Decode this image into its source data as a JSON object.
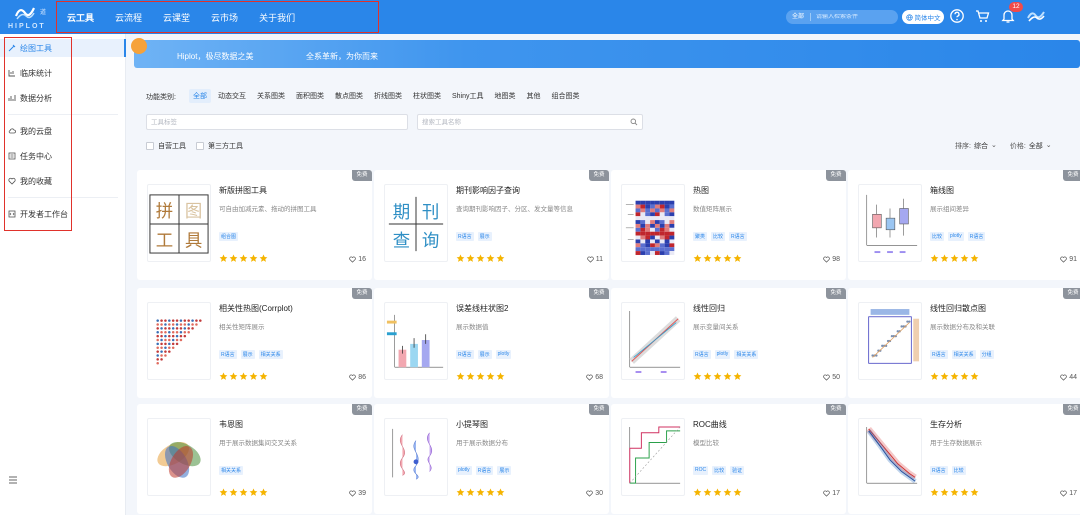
{
  "brand": {
    "name": "HIPLOT",
    "sub": "道"
  },
  "nav": {
    "items": [
      "云工具",
      "云流程",
      "云课堂",
      "云市场",
      "关于我们"
    ],
    "active": 0
  },
  "header": {
    "search_scope": "全部",
    "search_placeholder": "请输入检索条件",
    "lang_label": "简体中文",
    "notification_count": "12"
  },
  "sidebar": {
    "items": [
      {
        "label": "绘图工具",
        "icon": "brush-icon",
        "active": true
      },
      {
        "label": "临床统计",
        "icon": "chart-icon"
      },
      {
        "label": "数据分析",
        "icon": "analysis-icon"
      },
      {
        "label": "我的云盘",
        "icon": "cloud-icon"
      },
      {
        "label": "任务中心",
        "icon": "task-icon"
      },
      {
        "label": "我的收藏",
        "icon": "favorite-icon"
      },
      {
        "label": "开发者工作台",
        "icon": "developer-icon"
      }
    ]
  },
  "banner": {
    "text1": "Hiplot，极尽数据之美",
    "text2": "全系革新，为你而来"
  },
  "filters": {
    "label": "功能类别:",
    "chips": [
      "全部",
      "动态交互",
      "关系图类",
      "面积图类",
      "散点图类",
      "折线图类",
      "柱状图类",
      "Shiny工具",
      "地图类",
      "其他",
      "组合图类"
    ],
    "active_chip": 0,
    "tag_placeholder": "工具标签",
    "name_placeholder": "搜索工具名称",
    "self_built": "自营工具",
    "third_party": "第三方工具",
    "sort_label": "排序:",
    "sort_value": "综合",
    "price_label": "价格:",
    "price_value": "全部"
  },
  "cards": [
    {
      "title": "新版拼图工具",
      "desc": "可自由加减元素、拖动的拼图工具",
      "tags": [
        "组合图"
      ],
      "likes": "16",
      "badge": "免费",
      "thumb": "puzzle"
    },
    {
      "title": "期刊影响因子查询",
      "desc": "查询期刊影响因子、分区、发文量等信息",
      "tags": [
        "R语言",
        "展示"
      ],
      "likes": "11",
      "badge": "免费",
      "thumb": "journal"
    },
    {
      "title": "热图",
      "desc": "数值矩阵展示",
      "tags": [
        "聚类",
        "比较",
        "R语言"
      ],
      "likes": "98",
      "badge": "免费",
      "thumb": "heatmap"
    },
    {
      "title": "箱线图",
      "desc": "展示组间差异",
      "tags": [
        "比较",
        "plotly",
        "R语言"
      ],
      "likes": "91",
      "badge": "免费",
      "thumb": "boxplot"
    },
    {
      "title": "相关性热图(Corrplot)",
      "desc": "相关性矩阵展示",
      "tags": [
        "R语言",
        "展示",
        "相关关系"
      ],
      "likes": "86",
      "badge": "免费",
      "thumb": "corrplot"
    },
    {
      "title": "误差线柱状图2",
      "desc": "展示数据值",
      "tags": [
        "R语言",
        "展示",
        "plotly"
      ],
      "likes": "68",
      "badge": "免费",
      "thumb": "errorbar"
    },
    {
      "title": "线性回归",
      "desc": "展示变量间关系",
      "tags": [
        "R语言",
        "plotly",
        "相关关系"
      ],
      "likes": "50",
      "badge": "免费",
      "thumb": "regression"
    },
    {
      "title": "线性回归散点图",
      "desc": "展示数据分布及和关联",
      "tags": [
        "R语言",
        "相关关系",
        "分组"
      ],
      "likes": "44",
      "badge": "免费",
      "thumb": "regscatter"
    },
    {
      "title": "韦恩图",
      "desc": "用于展示数据集间交叉关系",
      "tags": [
        "相关关系"
      ],
      "likes": "39",
      "badge": "免费",
      "thumb": "venn"
    },
    {
      "title": "小提琴图",
      "desc": "用于展示数据分布",
      "tags": [
        "plotly",
        "R语言",
        "展示"
      ],
      "likes": "30",
      "badge": "免费",
      "thumb": "violin"
    },
    {
      "title": "ROC曲线",
      "desc": "模型比较",
      "tags": [
        "ROC",
        "比较",
        "验证"
      ],
      "likes": "17",
      "badge": "免费",
      "thumb": "roc"
    },
    {
      "title": "生存分析",
      "desc": "用于生存数据展示",
      "tags": [
        "R语言",
        "比较"
      ],
      "likes": "17",
      "badge": "免费",
      "thumb": "survival"
    }
  ],
  "colors": {
    "primary": "#2a86e9",
    "highlight": "#e0322b",
    "star": "#f5b400"
  }
}
